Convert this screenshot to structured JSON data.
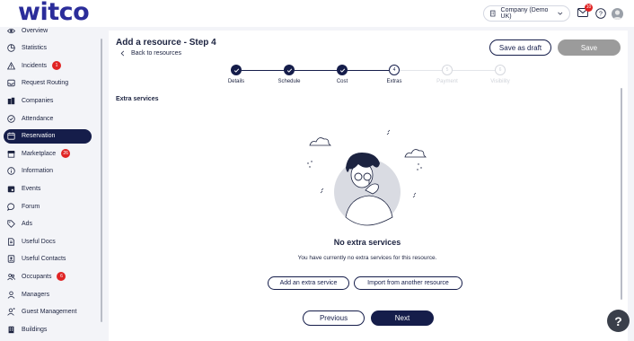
{
  "brand": {
    "logo_text": "witco",
    "accent": "#151d4a",
    "logo_color": "#2b2d9a",
    "badge_color": "#e02424"
  },
  "header": {
    "company": "Company (Demo UK)",
    "mail_badge": "10"
  },
  "sidebar": {
    "items": [
      {
        "label": "Overview",
        "icon": "eye-icon"
      },
      {
        "label": "Statistics",
        "icon": "pie-chart-icon"
      },
      {
        "label": "Incidents",
        "icon": "warning-icon",
        "badge": "1"
      },
      {
        "label": "Request Routing",
        "icon": "inbox-icon"
      },
      {
        "label": "Companies",
        "icon": "buildings-icon"
      },
      {
        "label": "Attendance",
        "icon": "check-circle-icon"
      },
      {
        "label": "Reservation",
        "icon": "calendar-icon",
        "active": true
      },
      {
        "label": "Marketplace",
        "icon": "store-icon",
        "badge": "26"
      },
      {
        "label": "Information",
        "icon": "info-icon"
      },
      {
        "label": "Events",
        "icon": "event-calendar-icon"
      },
      {
        "label": "Forum",
        "icon": "chat-icon"
      },
      {
        "label": "Ads",
        "icon": "tag-icon"
      },
      {
        "label": "Useful Docs",
        "icon": "document-icon"
      },
      {
        "label": "Useful Contacts",
        "icon": "contact-book-icon"
      },
      {
        "label": "Occupants",
        "icon": "users-icon",
        "badge": "6"
      },
      {
        "label": "Managers",
        "icon": "user-icon"
      },
      {
        "label": "Guest Management",
        "icon": "guest-icon"
      },
      {
        "label": "Buildings",
        "icon": "building-icon"
      }
    ]
  },
  "page": {
    "title": "Add a resource - Step 4",
    "back_label": "Back to resources",
    "save_draft_label": "Save as draft",
    "save_label": "Save"
  },
  "stepper": {
    "steps": [
      {
        "label": "Details",
        "state": "done"
      },
      {
        "label": "Schedule",
        "state": "done"
      },
      {
        "label": "Cost",
        "state": "done"
      },
      {
        "label": "Extras",
        "state": "current",
        "number": "4"
      },
      {
        "label": "Payment",
        "state": "todo",
        "number": "5"
      },
      {
        "label": "Visibility",
        "state": "todo",
        "number": "6"
      }
    ]
  },
  "extras": {
    "section_title": "Extra services",
    "empty_title": "No extra services",
    "empty_desc": "You have currently no extra services for this resource.",
    "add_label": "Add an extra service",
    "import_label": "Import from another resource"
  },
  "footer": {
    "prev_label": "Previous",
    "next_label": "Next"
  },
  "help_fab": "?"
}
